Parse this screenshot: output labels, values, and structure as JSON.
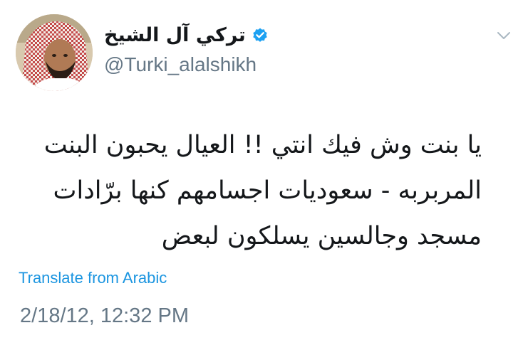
{
  "tweet": {
    "author": {
      "display_name": "تركي آل الشيخ",
      "handle": "@Turki_alalshikh",
      "verified": true
    },
    "text_lines": [
      "يا بنت وش فيك انتي !! العيال يحبون البنت",
      "المربربه - سعوديات اجسامهم كنها برّادات",
      "مسجد وجالسين يسلكون لبعض"
    ],
    "translate_label": "Translate from Arabic",
    "timestamp": "2/18/12, 12:32 PM"
  },
  "colors": {
    "verified_badge": "#1da1f2",
    "link": "#1b95e0",
    "secondary_text": "#657786",
    "primary_text": "#14171a"
  },
  "icons": {
    "verified": "verified-badge-icon",
    "menu": "chevron-down-icon"
  }
}
